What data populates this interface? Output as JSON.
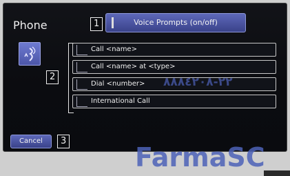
{
  "screen": {
    "title": "Phone",
    "voice_prompts_button": "Voice Prompts (on/off)",
    "commands": [
      {
        "label": "Call <name>"
      },
      {
        "label": "Call <name> at <type>"
      },
      {
        "label": "Dial <number>"
      },
      {
        "label": "International Call"
      }
    ],
    "cancel_button": "Cancel"
  },
  "callouts": {
    "one": "1",
    "two": "2",
    "three": "3"
  },
  "watermarks": {
    "brand": "FarmaSC",
    "arabic_number": "٢٢-٨٨٨٤٢٠٨"
  },
  "colors": {
    "accent": "#4c56a8",
    "watermark": "#4d62b8",
    "screen_bg": "#0b0c10"
  },
  "icons": {
    "voice": "voice-recognition-icon",
    "command": "voice-command-icon"
  }
}
